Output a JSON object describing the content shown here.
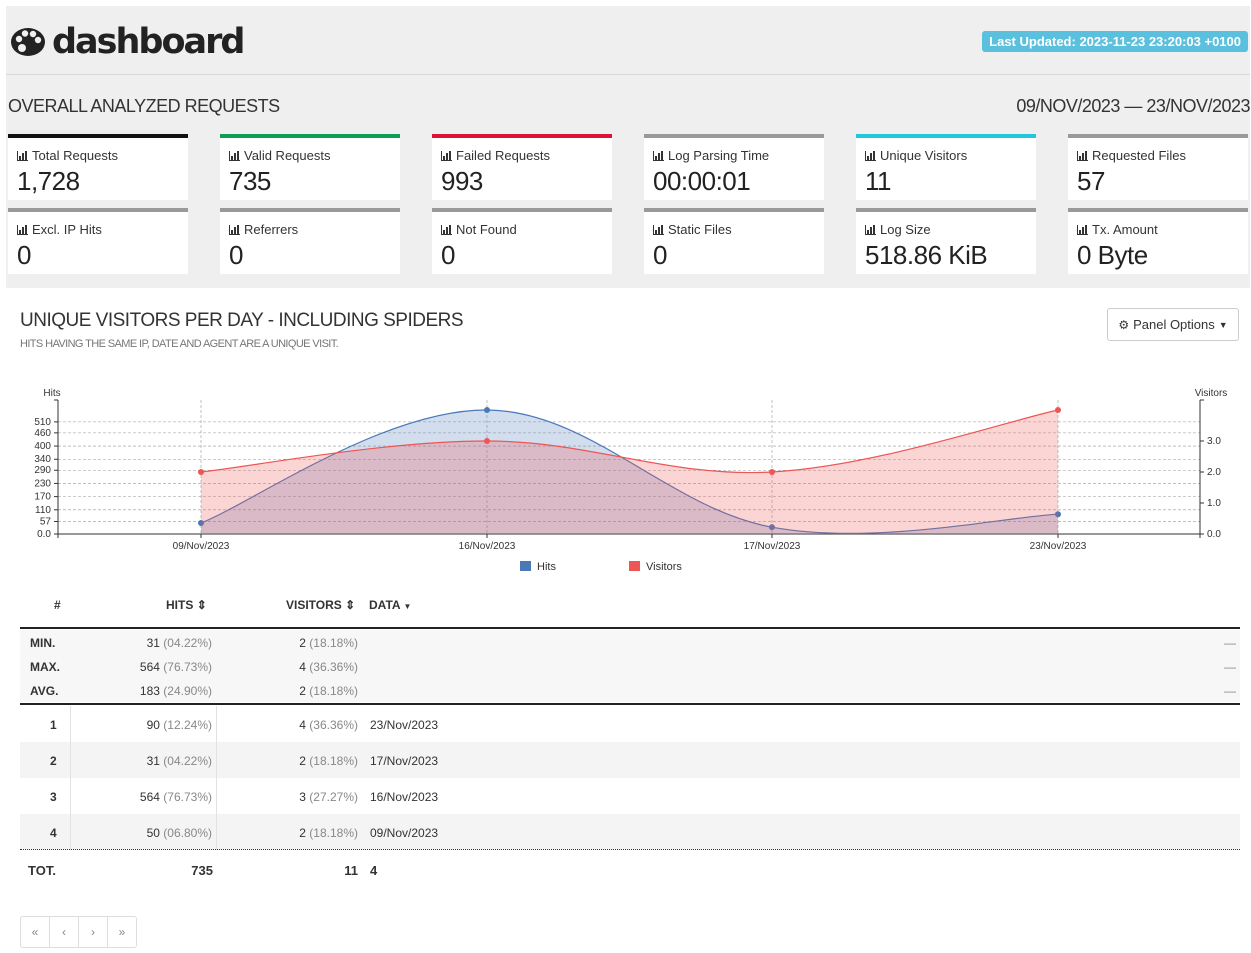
{
  "header": {
    "app_title": "dashboard",
    "last_updated": "Last Updated: 2023-11-23 23:20:03 +0100",
    "logo_icon": "palette-icon"
  },
  "overview": {
    "title": "OVERALL ANALYZED REQUESTS",
    "date_range": "09/NOV/2023 — 23/NOV/2023",
    "cards": [
      {
        "label": "Total Requests",
        "value": "1,728",
        "color": "#111111"
      },
      {
        "label": "Valid Requests",
        "value": "735",
        "color": "#0f9d58"
      },
      {
        "label": "Failed Requests",
        "value": "993",
        "color": "#dd1133"
      },
      {
        "label": "Log Parsing Time",
        "value": "00:00:01",
        "color": "#999999"
      },
      {
        "label": "Unique Visitors",
        "value": "11",
        "color": "#22c7dd"
      },
      {
        "label": "Requested Files",
        "value": "57",
        "color": "#999999"
      },
      {
        "label": "Excl. IP Hits",
        "value": "0",
        "color": "#999999"
      },
      {
        "label": "Referrers",
        "value": "0",
        "color": "#999999"
      },
      {
        "label": "Not Found",
        "value": "0",
        "color": "#999999"
      },
      {
        "label": "Static Files",
        "value": "0",
        "color": "#999999"
      },
      {
        "label": "Log Size",
        "value": "518.86 KiB",
        "color": "#999999"
      },
      {
        "label": "Tx. Amount",
        "value": "0 Byte",
        "color": "#999999"
      }
    ]
  },
  "panel": {
    "title": "UNIQUE VISITORS PER DAY - INCLUDING SPIDERS",
    "subtitle": "HITS HAVING THE SAME IP, DATE AND AGENT ARE A UNIQUE VISIT.",
    "options_label": "Panel Options"
  },
  "chart_data": {
    "type": "area",
    "categories": [
      "09/Nov/2023",
      "16/Nov/2023",
      "17/Nov/2023",
      "23/Nov/2023"
    ],
    "series": [
      {
        "name": "Hits",
        "values": [
          50,
          564,
          31,
          90
        ],
        "axis": "left",
        "color": "#4a78b8"
      },
      {
        "name": "Visitors",
        "values": [
          2,
          3,
          2,
          4
        ],
        "axis": "right",
        "color": "#ee5555"
      }
    ],
    "ylabel": "Hits",
    "y2label": "Visitors",
    "yticks": [
      "0.0",
      "57",
      "110",
      "170",
      "230",
      "290",
      "340",
      "400",
      "460",
      "510"
    ],
    "y2ticks": [
      "0.0",
      "1.0",
      "2.0",
      "3.0"
    ],
    "ylim": [
      0,
      564
    ],
    "y2lim": [
      0,
      4
    ],
    "legend": "bottom-center",
    "grid": true
  },
  "table": {
    "headers": {
      "num": "#",
      "hits": "HITS",
      "visitors": "VISITORS",
      "data": "DATA"
    },
    "summary": [
      {
        "label": "MIN.",
        "hits": "31",
        "hits_pct": "(04.22%)",
        "visitors": "2",
        "visitors_pct": "(18.18%)",
        "dash": "—"
      },
      {
        "label": "MAX.",
        "hits": "564",
        "hits_pct": "(76.73%)",
        "visitors": "4",
        "visitors_pct": "(36.36%)",
        "dash": "—"
      },
      {
        "label": "AVG.",
        "hits": "183",
        "hits_pct": "(24.90%)",
        "visitors": "2",
        "visitors_pct": "(18.18%)",
        "dash": "—"
      }
    ],
    "rows": [
      {
        "num": "1",
        "hits": "90",
        "hits_pct": "(12.24%)",
        "visitors": "4",
        "visitors_pct": "(36.36%)",
        "data": "23/Nov/2023"
      },
      {
        "num": "2",
        "hits": "31",
        "hits_pct": "(04.22%)",
        "visitors": "2",
        "visitors_pct": "(18.18%)",
        "data": "17/Nov/2023"
      },
      {
        "num": "3",
        "hits": "564",
        "hits_pct": "(76.73%)",
        "visitors": "3",
        "visitors_pct": "(27.27%)",
        "data": "16/Nov/2023"
      },
      {
        "num": "4",
        "hits": "50",
        "hits_pct": "(06.80%)",
        "visitors": "2",
        "visitors_pct": "(18.18%)",
        "data": "09/Nov/2023"
      }
    ],
    "total": {
      "label": "TOT.",
      "hits": "735",
      "visitors": "11",
      "data": "4"
    }
  },
  "pager": {
    "first": "«",
    "prev": "‹",
    "next": "›",
    "last": "»"
  }
}
